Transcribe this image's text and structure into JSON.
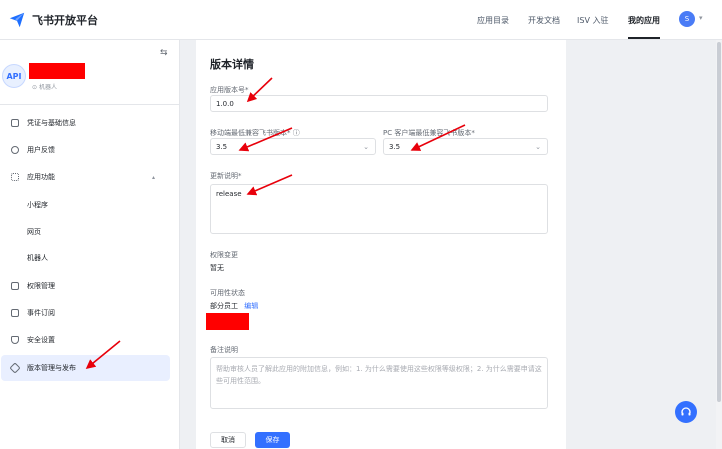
{
  "header": {
    "logo_text": "飞书开放平台",
    "nav": [
      {
        "label": "应用目录"
      },
      {
        "label": "开发文档"
      },
      {
        "label": "ISV 入驻"
      },
      {
        "label": "我的应用",
        "active": true
      }
    ],
    "user_initial": "S",
    "caret": "▾"
  },
  "sidebar": {
    "collapse_icon": "⇆",
    "app_avatar": "API",
    "app_type": "机器人",
    "items": [
      {
        "label": "凭证与基础信息",
        "icon": "credential-icon"
      },
      {
        "label": "用户反馈",
        "icon": "feedback-icon"
      },
      {
        "label": "应用功能",
        "icon": "grid-icon",
        "caret": "▴"
      },
      {
        "label": "小程序"
      },
      {
        "label": "网页"
      },
      {
        "label": "机器人"
      },
      {
        "label": "权限管理",
        "icon": "lock-icon"
      },
      {
        "label": "事件订阅",
        "icon": "event-icon"
      },
      {
        "label": "安全设置",
        "icon": "shield-icon"
      },
      {
        "label": "版本管理与发布",
        "icon": "layers-icon",
        "active": true
      }
    ]
  },
  "main": {
    "title": "版本详情",
    "version_label": "应用版本号*",
    "version_value": "1.0.0",
    "mobile_label": "移动端最低兼容飞书版本*",
    "mobile_value": "3.5",
    "pc_label": "PC 客户端最低兼容飞书版本*",
    "pc_value": "3.5",
    "desc_label": "更新说明*",
    "desc_value": "release",
    "perm_label": "权限变更",
    "perm_value": "暂无",
    "avail_label": "可用性状态",
    "avail_value": "部分员工",
    "avail_edit": "编辑",
    "remark_label": "备注说明",
    "remark_placeholder": "帮助审核人员了解此应用的附加信息，例如：1. 为什么需要使用这些权限等级权限；2. 为什么需要申请这些可用性范围。",
    "cancel_label": "取消",
    "save_label": "保存"
  },
  "colors": {
    "accent": "#3370ff",
    "redaction": "#ff0000",
    "annotation_arrow": "#e8000b"
  }
}
